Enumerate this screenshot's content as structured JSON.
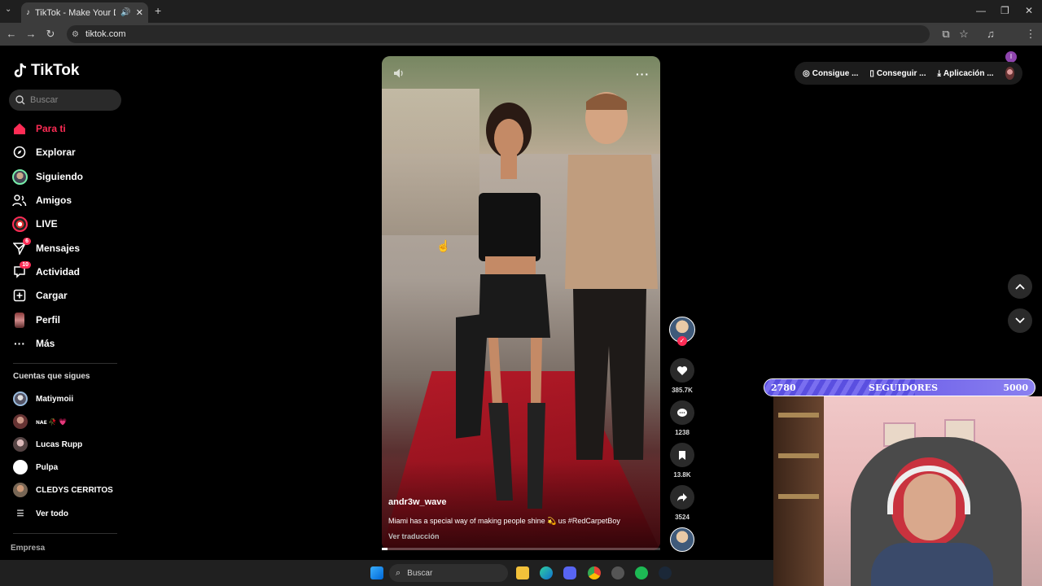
{
  "browser": {
    "tab_title": "TikTok - Make Your Day",
    "url": "tiktok.com"
  },
  "sidebar": {
    "logo_text": "TikTok",
    "search_placeholder": "Buscar",
    "nav": [
      {
        "label": "Para ti",
        "icon": "home-icon",
        "active": true
      },
      {
        "label": "Explorar",
        "icon": "compass-icon"
      },
      {
        "label": "Siguiendo",
        "icon": "following-avatar-icon"
      },
      {
        "label": "Amigos",
        "icon": "friends-icon"
      },
      {
        "label": "LIVE",
        "icon": "live-icon"
      },
      {
        "label": "Mensajes",
        "icon": "send-icon",
        "badge": "6"
      },
      {
        "label": "Actividad",
        "icon": "activity-icon",
        "badge": "10"
      },
      {
        "label": "Cargar",
        "icon": "upload-icon"
      },
      {
        "label": "Perfil",
        "icon": "profile-avatar-icon"
      },
      {
        "label": "Más",
        "icon": "more-dots-icon"
      }
    ],
    "following_title": "Cuentas que sigues",
    "accounts": [
      {
        "name": "Matiymoii"
      },
      {
        "name": "ɴᴀᴇ 🥀 💗"
      },
      {
        "name": "Lucas Rupp"
      },
      {
        "name": "Pulpa"
      },
      {
        "name": "CLEDYS CERRITOS"
      }
    ],
    "see_all": "Ver todo",
    "footer_company": "Empresa"
  },
  "video": {
    "author": "andr3w_wave",
    "caption": "Miami has a special way of making people shine 💫 us #RedCarpetBoy",
    "translate": "Ver traducción"
  },
  "actions": {
    "likes": "385.7K",
    "comments": "1238",
    "saves": "13.8K",
    "shares": "3524"
  },
  "topright": {
    "coins": "Consigue ...",
    "app_get": "Conseguir ...",
    "app": "Aplicación ..."
  },
  "stream_overlay": {
    "current": "2780",
    "label": "SEGUIDORES",
    "goal": "5000",
    "progress": 0.556
  },
  "taskbar": {
    "search_placeholder": "Buscar"
  },
  "colors": {
    "accent": "#fe2c55",
    "background": "#000000",
    "overlay_bar": "#5a4fe0"
  }
}
